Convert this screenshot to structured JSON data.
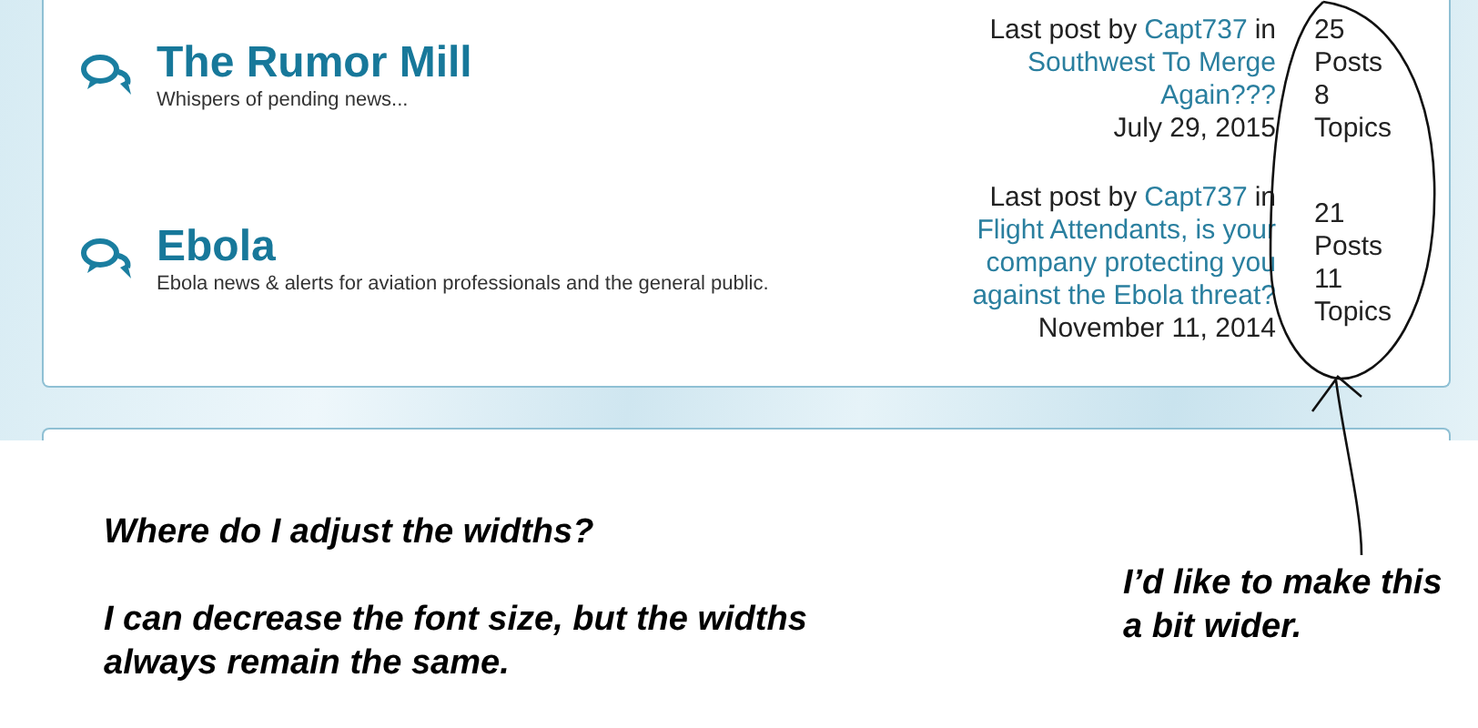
{
  "forums": [
    {
      "title": "The Rumor Mill",
      "description": "Whispers of pending news...",
      "last_post": {
        "prefix": "Last post by",
        "author": "Capt737",
        "joiner": "in",
        "topic": "Southwest To Merge Again???",
        "date": "July 29, 2015"
      },
      "posts": "25",
      "posts_label": "Posts",
      "topics": "8",
      "topics_label": "Topics"
    },
    {
      "title": "Ebola",
      "description": "Ebola news & alerts for aviation professionals and the general public.",
      "last_post": {
        "prefix": "Last post by",
        "author": "Capt737",
        "joiner": "in",
        "topic": "Flight Attendants, is your company protecting you against the Ebola threat?",
        "date": "November 11, 2014"
      },
      "posts": "21",
      "posts_label": "Posts",
      "topics": "11",
      "topics_label": "Topics"
    }
  ],
  "annotations": {
    "question": [
      "Where do I adjust the widths?",
      "I can decrease the font size, but the widths always remain the same."
    ],
    "pointer_note": "I’d like to make this a bit wider."
  }
}
